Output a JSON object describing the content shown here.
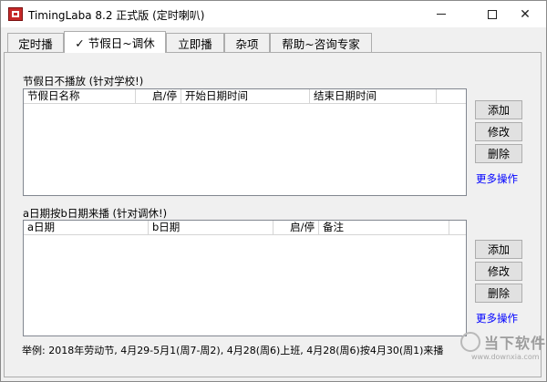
{
  "window": {
    "title": "TimingLaba 8.2 正式版  (定时喇叭)",
    "min_glyph": "—",
    "max_glyph": "☐",
    "close_glyph": "✕"
  },
  "tabs": [
    {
      "label": "定时播",
      "active": false
    },
    {
      "label": "✓ 节假日~调休",
      "active": true
    },
    {
      "label": "立即播",
      "active": false
    },
    {
      "label": "杂项",
      "active": false
    },
    {
      "label": "帮助~咨询专家",
      "active": false
    }
  ],
  "holiday_section": {
    "label": "节假日不播放 (针对学校!)",
    "columns": [
      "节假日名称",
      "启/停",
      "开始日期时间",
      "结束日期时间"
    ],
    "rows": [],
    "buttons": {
      "add": "添加",
      "edit": "修改",
      "delete": "删除"
    },
    "more": "更多操作"
  },
  "swap_section": {
    "label": "a日期按b日期来播 (针对调休!)",
    "columns": [
      "a日期",
      "b日期",
      "启/停",
      "备注"
    ],
    "rows": [],
    "buttons": {
      "add": "添加",
      "edit": "修改",
      "delete": "删除"
    },
    "more": "更多操作"
  },
  "example_text": "举例:  2018年劳动节, 4月29-5月1(周7-周2), 4月28(周6)上班, 4月28(周6)按4月30(周1)来播",
  "watermark": {
    "brand": "当下软件园",
    "url": "www.downxia.com"
  },
  "colors": {
    "link": "#0000ff",
    "app_icon": "#c62828"
  }
}
